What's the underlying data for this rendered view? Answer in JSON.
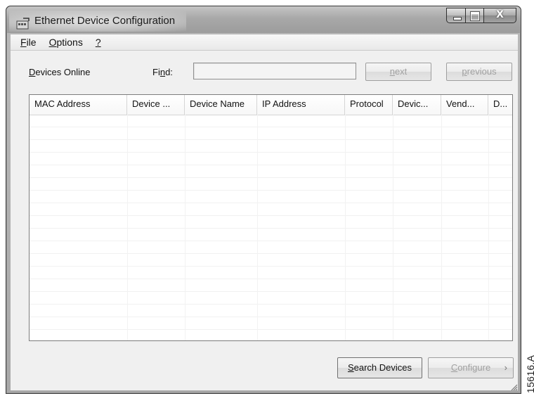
{
  "window": {
    "title": "Ethernet Device Configuration",
    "buttons": {
      "minimize": "minimize-icon",
      "maximize": "maximize-icon",
      "close": "X"
    }
  },
  "menu": {
    "items": [
      {
        "accel": "F",
        "rest": "ile"
      },
      {
        "accel": "O",
        "rest": "ptions"
      },
      {
        "accel": "?",
        "rest": ""
      }
    ]
  },
  "toolbar": {
    "devices_online_accel": "D",
    "devices_online_rest": "evices Online",
    "find_pre": "Fi",
    "find_accel": "n",
    "find_post": "d:",
    "find_value": "",
    "next_accel": "n",
    "next_rest": "ext",
    "previous_accel": "p",
    "previous_rest": "revious"
  },
  "grid": {
    "columns": [
      "MAC Address",
      "Device ...",
      "Device Name",
      "IP Address",
      "Protocol",
      "Devic...",
      "Vend...",
      "D..."
    ],
    "rows": []
  },
  "footer": {
    "search_accel": "S",
    "search_rest": "earch Devices",
    "configure_accel": "C",
    "configure_rest": "onfigure",
    "configure_arrow": "›"
  },
  "figure_id": "15616.A"
}
